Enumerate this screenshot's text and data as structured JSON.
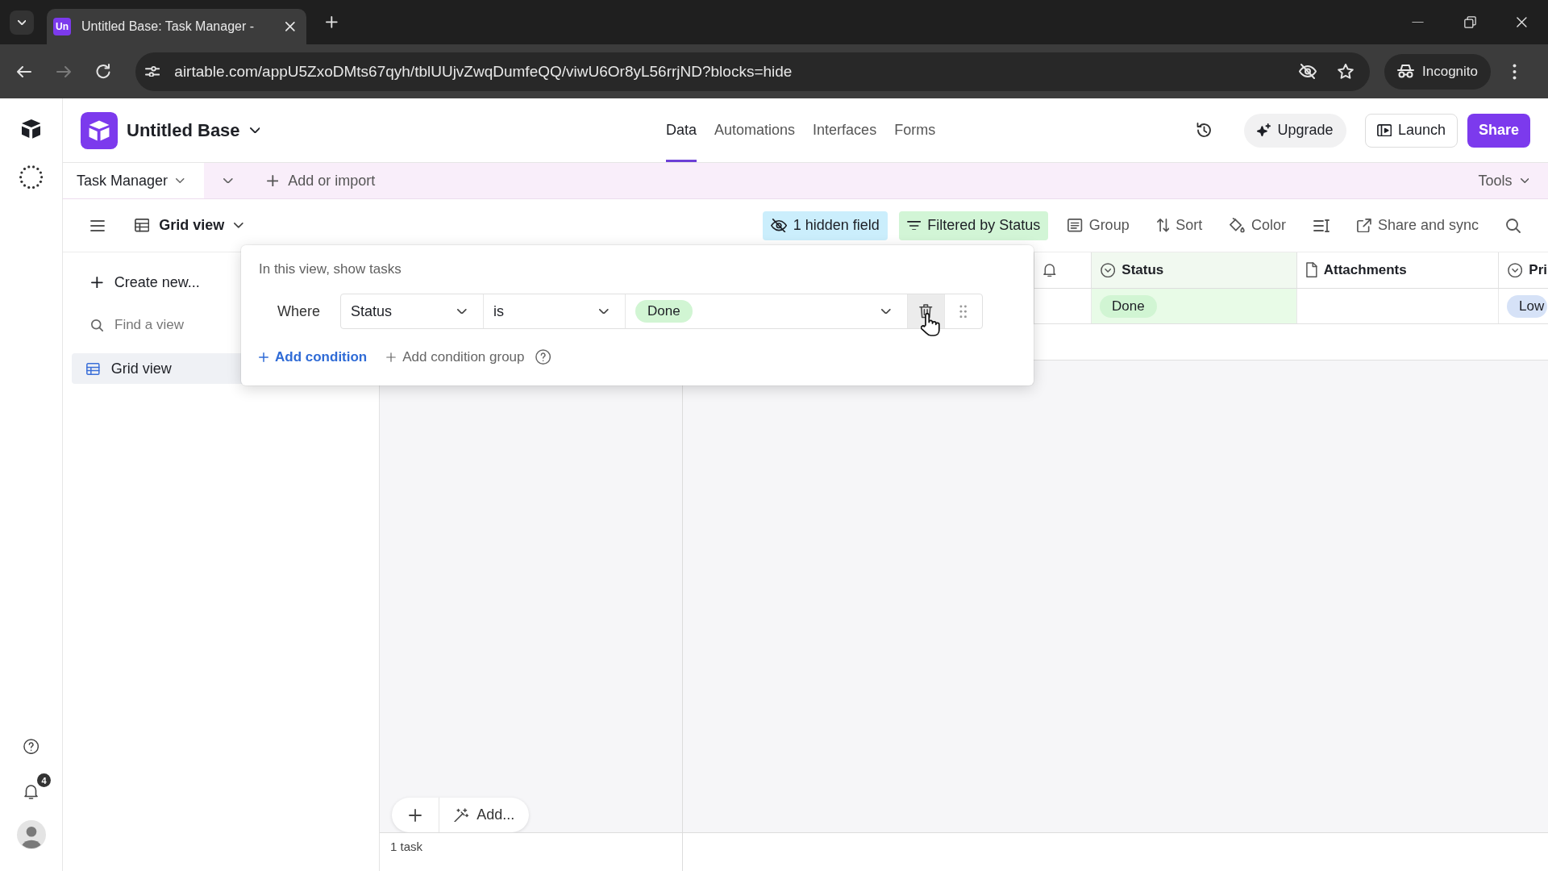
{
  "browser": {
    "tab": {
      "favicon": "Un",
      "title": "Untitled Base: Task Manager -",
      "selected": true
    },
    "url": "airtable.com/appU5ZxoDMts67qyh/tblUUjvZwqDumfeQQ/viwU6Or8yL56rrjND?blocks=hide",
    "profile": "Incognito"
  },
  "rail": {
    "notifications": "4"
  },
  "header": {
    "base_name": "Untitled Base",
    "nav": [
      {
        "label": "Data",
        "selected": true
      },
      {
        "label": "Automations",
        "selected": false
      },
      {
        "label": "Interfaces",
        "selected": false
      },
      {
        "label": "Forms",
        "selected": false
      }
    ],
    "actions": [
      {
        "kind": "upgrade",
        "label": "Upgrade"
      },
      {
        "kind": "launch",
        "label": "Launch"
      },
      {
        "kind": "share",
        "label": "Share"
      }
    ]
  },
  "table_bar": {
    "tables": [
      {
        "label": "Task Manager",
        "selected": true
      }
    ],
    "add_label": "Add or import",
    "tools_label": "Tools"
  },
  "view_bar": {
    "view_name": "Grid view",
    "tools": [
      {
        "kind": "hidden_fields",
        "label": "1 hidden field"
      },
      {
        "kind": "filter",
        "label": "Filtered by Status"
      },
      {
        "kind": "group",
        "label": "Group"
      },
      {
        "kind": "sort",
        "label": "Sort"
      },
      {
        "kind": "color",
        "label": "Color"
      },
      {
        "kind": "row_height"
      },
      {
        "kind": "share_sync",
        "label": "Share and sync"
      },
      {
        "kind": "search"
      }
    ]
  },
  "sidebar": {
    "create_label": "Create new...",
    "search_placeholder": "Find a view",
    "views": [
      {
        "label": "Grid view",
        "selected": true
      }
    ]
  },
  "grid": {
    "columns": [
      {
        "kind": "reminder",
        "filtered": false
      },
      {
        "kind": "single_select",
        "label": "Status",
        "filtered": true
      },
      {
        "kind": "attachment",
        "label": "Attachments",
        "filtered": false
      },
      {
        "kind": "single_select",
        "label": "Pri",
        "filtered": false
      }
    ],
    "rows": [
      {
        "cells": [
          {
            "kind": "empty"
          },
          {
            "kind": "tag",
            "label": "Done",
            "color": "#d1f5d3"
          },
          {
            "kind": "empty"
          },
          {
            "kind": "tag",
            "label": "Low",
            "color": "#d6e2f7"
          }
        ]
      }
    ],
    "add_label": "Add...",
    "record_count": "1 task"
  },
  "filter_popup": {
    "title": "In this view, show tasks",
    "conditions": [
      {
        "conjunction": "Where",
        "field": "Status",
        "operator": "is",
        "value": {
          "label": "Done",
          "color": "#d1f5d3"
        },
        "delete_hovered": true
      }
    ],
    "add_condition": "Add condition",
    "add_group": "Add condition group"
  }
}
